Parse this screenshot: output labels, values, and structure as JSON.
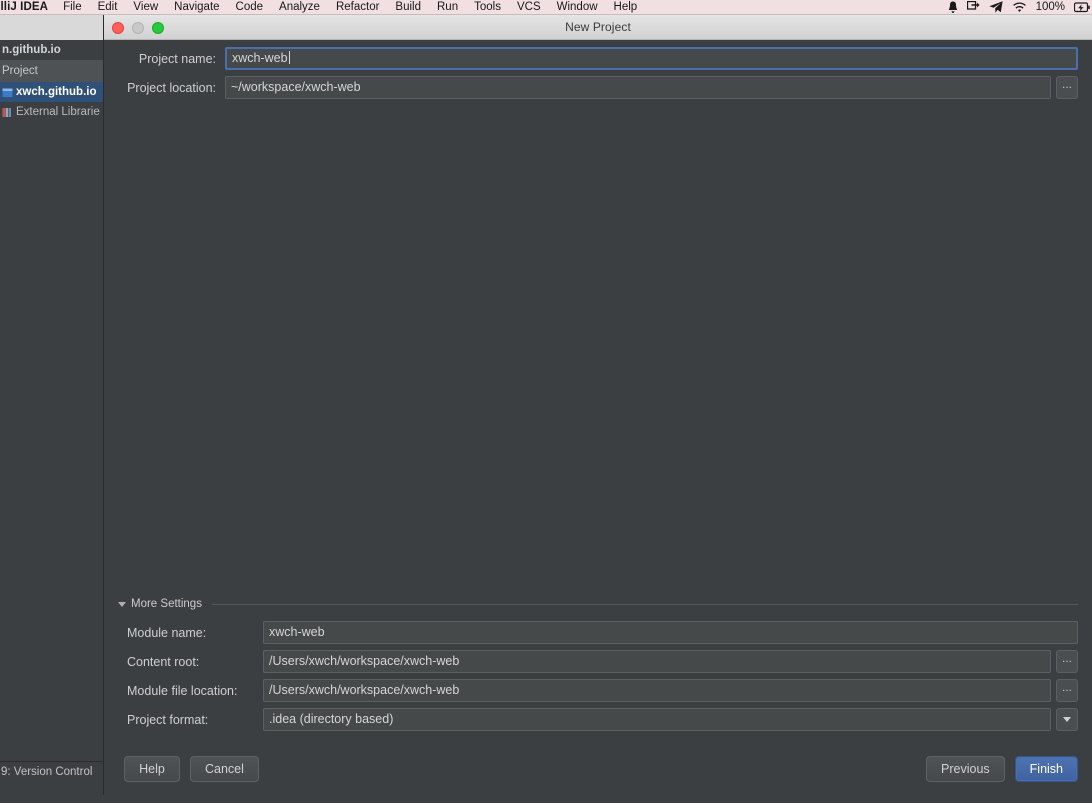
{
  "menubar": {
    "app_name": "elliJ IDEA",
    "items": [
      "File",
      "Edit",
      "View",
      "Navigate",
      "Code",
      "Analyze",
      "Refactor",
      "Build",
      "Run",
      "Tools",
      "VCS",
      "Window",
      "Help"
    ],
    "status": {
      "notification_icon": "bell-icon",
      "screenshare_icon": "screen-share-icon",
      "telegram_icon": "telegram-send-icon",
      "wifi_icon": "wifi-icon",
      "battery_percent": "100%",
      "battery_icon": "battery-charging-icon"
    }
  },
  "sidebar": {
    "project_header": "n.github.io",
    "tab_label": "Project",
    "tree": [
      {
        "label": "xwch.github.io",
        "icon": "module-icon",
        "selected": true
      },
      {
        "label": "External Librarie",
        "icon": "library-icon",
        "selected": false
      }
    ],
    "status_bar": "9: Version Control"
  },
  "dialog": {
    "title": "New Project",
    "window_controls": {
      "close": "close-traffic-light",
      "minimize": "minimize-traffic-light",
      "zoom": "zoom-traffic-light"
    },
    "fields": {
      "project_name": {
        "label": "Project name:",
        "value": "xwch-web",
        "placeholder": "",
        "focused": true
      },
      "project_location": {
        "label": "Project location:",
        "value": "~/workspace/xwch-web",
        "placeholder": "",
        "browse_label": "..."
      }
    },
    "more_settings": {
      "label": "More Settings",
      "expanded": true,
      "rows": [
        {
          "label": "Module name:",
          "value": "xwch-web",
          "trailing": "none"
        },
        {
          "label": "Content root:",
          "value": "/Users/xwch/workspace/xwch-web",
          "trailing": "browse",
          "browse_label": "..."
        },
        {
          "label": "Module file location:",
          "value": "/Users/xwch/workspace/xwch-web",
          "trailing": "browse",
          "browse_label": "..."
        },
        {
          "label": "Project format:",
          "value": ".idea (directory based)",
          "trailing": "combo"
        }
      ]
    },
    "buttons": {
      "help": "Help",
      "cancel": "Cancel",
      "previous": "Previous",
      "finish": "Finish"
    }
  },
  "colors": {
    "dialog_bg": "#3c3f41",
    "field_bg": "#45494a",
    "accent_focus": "#4b6eaf",
    "selection_blue": "#2f5079",
    "menubar_bg": "#f2dfe2",
    "titlebar_bg": "#d9d9d9"
  }
}
